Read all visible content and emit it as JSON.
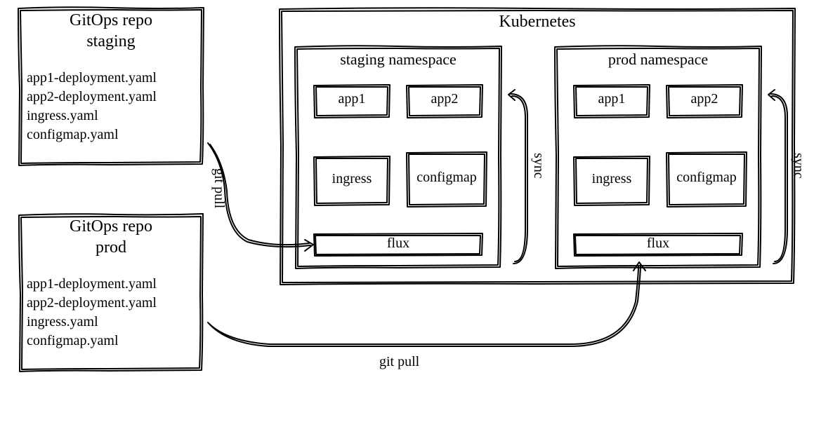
{
  "repos": {
    "staging": {
      "title_line1": "GitOps repo",
      "title_line2": "staging",
      "files": [
        "app1-deployment.yaml",
        "app2-deployment.yaml",
        "ingress.yaml",
        "configmap.yaml"
      ]
    },
    "prod": {
      "title_line1": "GitOps repo",
      "title_line2": "prod",
      "files": [
        "app1-deployment.yaml",
        "app2-deployment.yaml",
        "ingress.yaml",
        "configmap.yaml"
      ]
    }
  },
  "cluster": {
    "title": "Kubernetes",
    "namespaces": {
      "staging": {
        "title": "staging namespace",
        "resources": {
          "app1": "app1",
          "app2": "app2",
          "ingress": "ingress",
          "configmap": "configmap"
        },
        "flux_label": "flux",
        "sync_label": "sync"
      },
      "prod": {
        "title": "prod namespace",
        "resources": {
          "app1": "app1",
          "app2": "app2",
          "ingress": "ingress",
          "configmap": "configmap"
        },
        "flux_label": "flux",
        "sync_label": "sync"
      }
    }
  },
  "arrows": {
    "git_pull_staging": "git pull",
    "git_pull_prod": "git pull"
  }
}
